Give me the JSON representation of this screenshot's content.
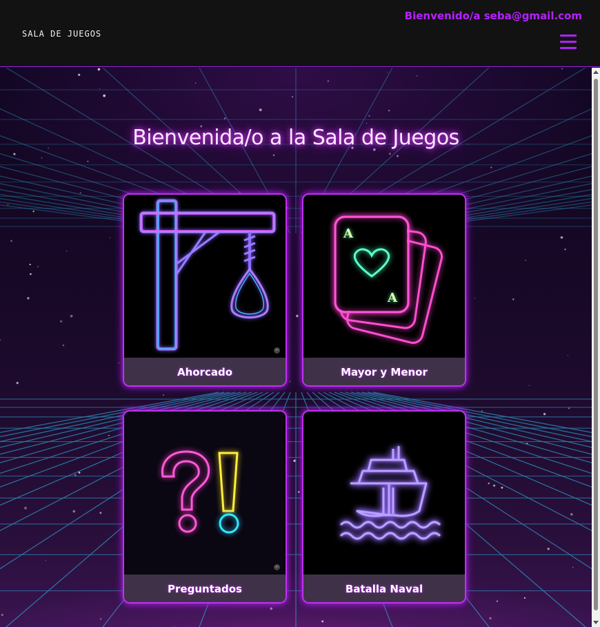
{
  "navbar": {
    "brand": "Sala de Juegos",
    "welcome_text": "Bienvenido/a seba@gmail.com",
    "menu_icon": "hamburger-menu-icon"
  },
  "main": {
    "title": "Bienvenida/o a la Sala de Juegos",
    "games": [
      {
        "label": "Ahorcado",
        "icon": "gallows-noose-icon"
      },
      {
        "label": "Mayor y Menor",
        "icon": "playing-cards-icon"
      },
      {
        "label": "Preguntados",
        "icon": "question-exclamation-icon"
      },
      {
        "label": "Batalla Naval",
        "icon": "ship-icon"
      }
    ]
  },
  "colors": {
    "accent": "#b620ff",
    "navbar_bg": "#121212",
    "card_border": "#c030f0",
    "grid_line": "#2fb0d8"
  }
}
